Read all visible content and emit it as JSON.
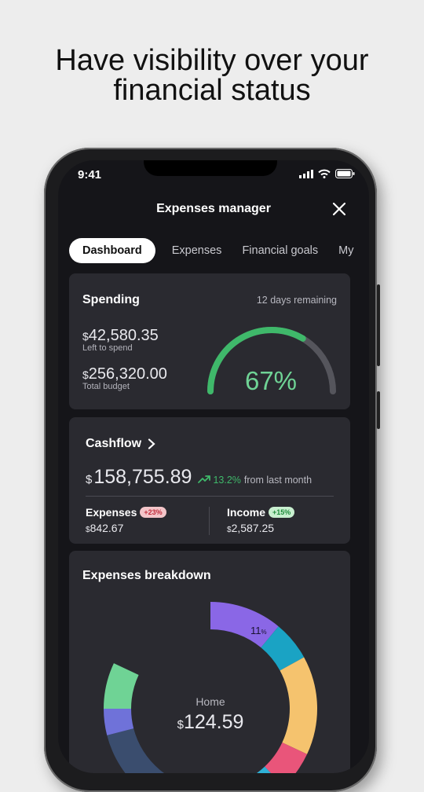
{
  "headline": [
    "Have visibility over your",
    "financial status"
  ],
  "status_bar": {
    "time": "9:41"
  },
  "header": {
    "title": "Expenses manager"
  },
  "tabs": [
    {
      "label": "Dashboard",
      "active": true
    },
    {
      "label": "Expenses",
      "active": false
    },
    {
      "label": "Financial goals",
      "active": false
    },
    {
      "label": "My",
      "active": false
    }
  ],
  "spending": {
    "title": "Spending",
    "remaining": "12 days remaining",
    "left_currency": "$",
    "left_amount": "42,580.35",
    "left_label": "Left to spend",
    "budget_currency": "$",
    "budget_amount": "256,320.00",
    "budget_label": "Total budget",
    "gauge_percent_label": "67%",
    "gauge_fraction": 0.67,
    "gauge_color": "#3fb86a",
    "gauge_track_color": "#55555c"
  },
  "cashflow": {
    "title": "Cashflow",
    "currency": "$",
    "amount": "158,755.89",
    "trend_percent": "13.2%",
    "trend_text": "from last month",
    "trend_color": "#3fb86a",
    "expenses_label": "Expenses",
    "expenses_badge": "+23%",
    "expenses_currency": "$",
    "expenses_value": "842.67",
    "income_label": "Income",
    "income_badge": "+15%",
    "income_currency": "$",
    "income_value": "2,587.25"
  },
  "breakdown": {
    "title": "Expenses breakdown",
    "center_label": "Home",
    "center_currency": "$",
    "center_amount": "124.59",
    "slice_label_value": "11",
    "slice_label_unit": "%",
    "segments": [
      {
        "color": "#8a67e6",
        "fraction": 0.11
      },
      {
        "color": "#1aa3c4",
        "fraction": 0.06
      },
      {
        "color": "#f5c36e",
        "fraction": 0.15
      },
      {
        "color": "#e9557a",
        "fraction": 0.06
      },
      {
        "color": "#2fb1d6",
        "fraction": 0.13
      },
      {
        "color": "#3a4d6e",
        "fraction": 0.2
      },
      {
        "color": "#6f72d9",
        "fraction": 0.04
      },
      {
        "color": "#6fd395",
        "fraction": 0.07
      }
    ]
  }
}
